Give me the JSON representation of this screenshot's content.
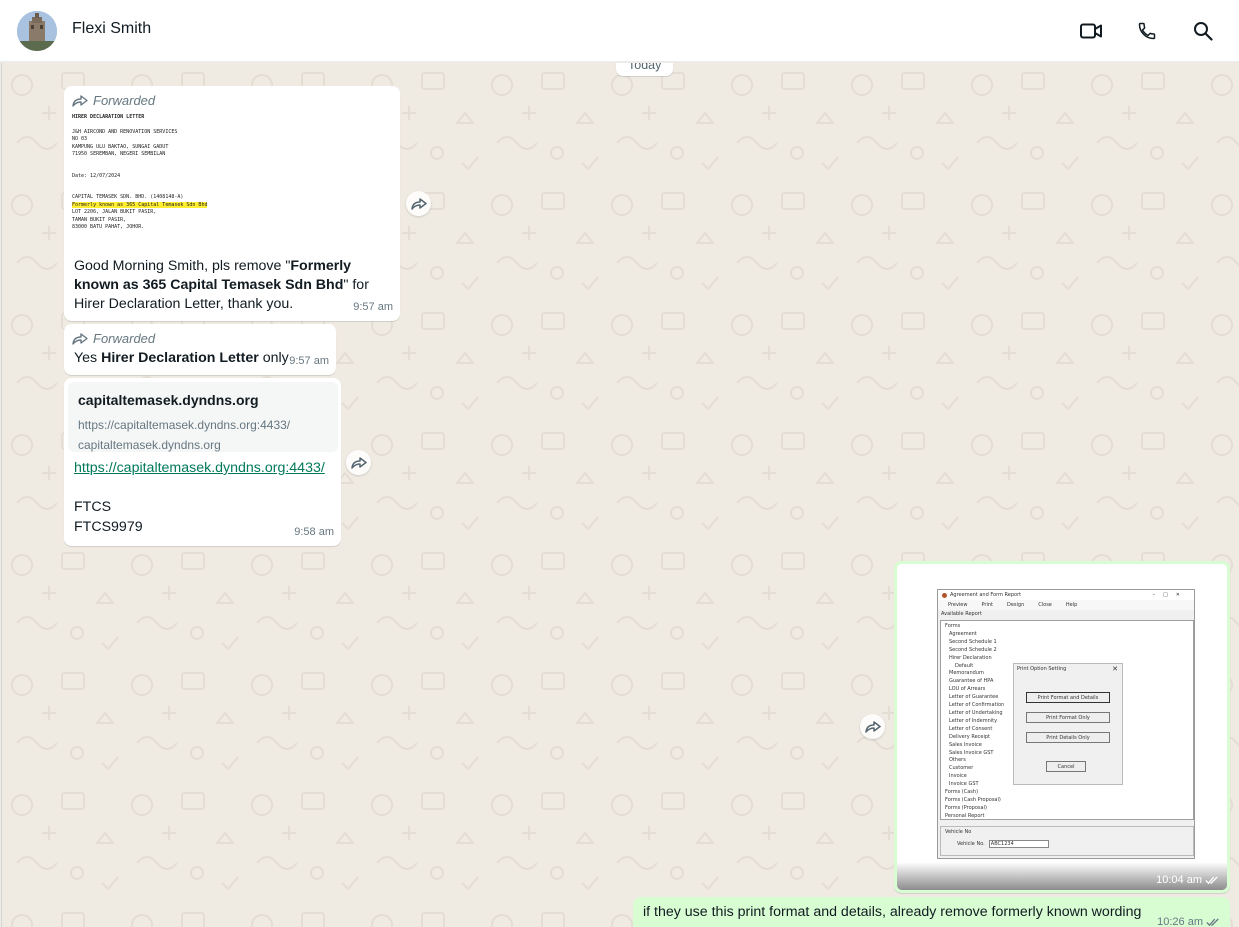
{
  "header": {
    "contact_name": "Flexi Smith",
    "icons": [
      "video-call-icon",
      "voice-call-icon",
      "search-icon"
    ]
  },
  "chat": {
    "date_divider": "Today",
    "messages": [
      {
        "forwarded_label": "Forwarded",
        "document_lines": [
          "HIRER DECLARATION LETTER",
          "J&H AIRCOND AND RENOVATION SERVICES",
          "NO 03",
          "KAMPUNG ULU BAKTAO, SUNGAI GADUT",
          "71950 SEREMBAN, NEGERI SEMBILAN",
          "",
          "Date: 12/07/2024",
          "",
          "CAPITAL TEMASEK SDN. BHD. (1408148-A)",
          "Formerly known as 365 Capital Temasek Sdn Bhd",
          "LOT 2206, JALAN BUKIT PASIR,",
          "TAMAN BUKIT PASIR,",
          "83000 BATU PAHAT, JOHOR."
        ],
        "text_prefix": "Good Morning Smith, pls remove \"",
        "text_bold": "Formerly known as 365 Capital Temasek Sdn Bhd",
        "text_suffix": "\" for Hirer Declaration Letter, thank you.",
        "time": "9:57 am"
      },
      {
        "forwarded_label": "Forwarded",
        "text_prefix": "Yes ",
        "text_bold": "Hirer Declaration Letter",
        "text_suffix": " only",
        "time": "9:57 am"
      },
      {
        "link_title": "capitaltemasek.dyndns.org",
        "link_url_preview": "https://capitaltemasek.dyndns.org:4433/",
        "link_domain": "capitaltemasek.dyndns.org",
        "link_text": "https://capitaltemasek.dyndns.org:4433/",
        "line1": "FTCS",
        "line2": "FTCS9979",
        "time": "9:58 am"
      },
      {
        "image_description_text": {
          "window_title": "Agreement and Form Report",
          "menu": [
            "Preview",
            "Print",
            "Design",
            "Close",
            "Help"
          ],
          "available_report": "Available Report",
          "tree": [
            "Forms",
            "Agreement",
            "Second Schedule 1",
            "Second Schedule 2",
            "Hirer Declaration",
            "Default",
            "Memorandum",
            "Guarantee of HPA",
            "LOU of Arrears",
            "Letter of Guarantee",
            "Letter of Confirmation",
            "Letter of Undertaking",
            "Letter of Indemnity",
            "Letter of Consent",
            "Delivery Receipt",
            "Sales Invoice",
            "Sales Invoice GST",
            "Others",
            "Customer",
            "Invoice",
            "Invoice GST",
            "Forms (Cash)",
            "Forms (Cash Proposal)",
            "Forms (Proposal)",
            "Personal Report"
          ],
          "dialog_title": "Print Option Setting",
          "dialog_buttons": [
            "Print Format and Details",
            "Print Format Only",
            "Print Details Only",
            "Cancel"
          ],
          "vehicle_label": "Vehicle No",
          "vehicle_no_label": "Vehicle No.",
          "vehicle_no_value": "ABC1234"
        },
        "time": "10:04 am"
      },
      {
        "text": "if they use this print format and details, already remove formerly known wording",
        "time": "10:26 am"
      }
    ]
  },
  "colors": {
    "chat_bg": "#efeae2",
    "incoming_bubble": "#ffffff",
    "outgoing_bubble": "#d9fdd3",
    "highlight": "#ffee32",
    "link": "#027a5a"
  }
}
